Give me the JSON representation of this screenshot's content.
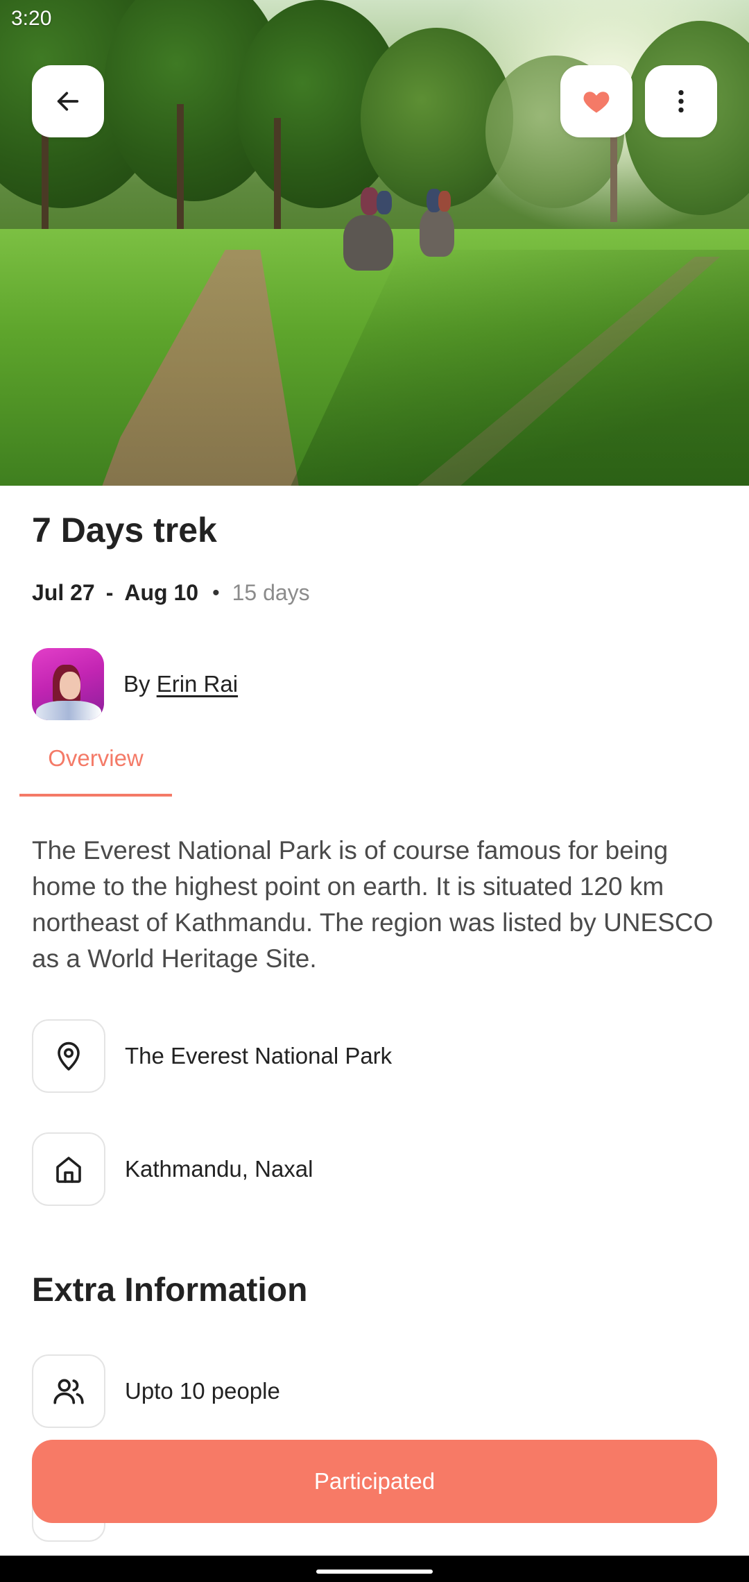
{
  "status_bar": {
    "time": "3:20"
  },
  "header": {
    "back_icon": "arrow-left-icon",
    "favorite_icon": "heart-icon",
    "favorite_color": "#F47A67",
    "more_icon": "more-vertical-icon"
  },
  "trip": {
    "title": "7 Days trek",
    "start_date": "Jul 27",
    "date_separator": "-",
    "end_date": "Aug 10",
    "bullet": "•",
    "duration": "15 days"
  },
  "author": {
    "prefix": "By",
    "name": "Erin Rai"
  },
  "tabs": [
    {
      "label": "Overview",
      "active": true
    }
  ],
  "overview": {
    "description": "The Everest National Park is of course famous for being home to the highest point on earth. It is situated 120 km northeast of Kathmandu. The region was listed by UNESCO as a World Heritage Site."
  },
  "details": [
    {
      "icon": "map-pin-icon",
      "label": "The Everest National Park"
    },
    {
      "icon": "home-icon",
      "label": "Kathmandu, Naxal"
    }
  ],
  "extra": {
    "title": "Extra Information",
    "items": [
      {
        "icon": "users-icon",
        "label": "Upto 10 people"
      }
    ]
  },
  "cta": {
    "label": "Participated",
    "color": "#F77A66"
  },
  "colors": {
    "accent": "#F47A67",
    "text": "#222222",
    "muted": "#8B8B8B"
  }
}
